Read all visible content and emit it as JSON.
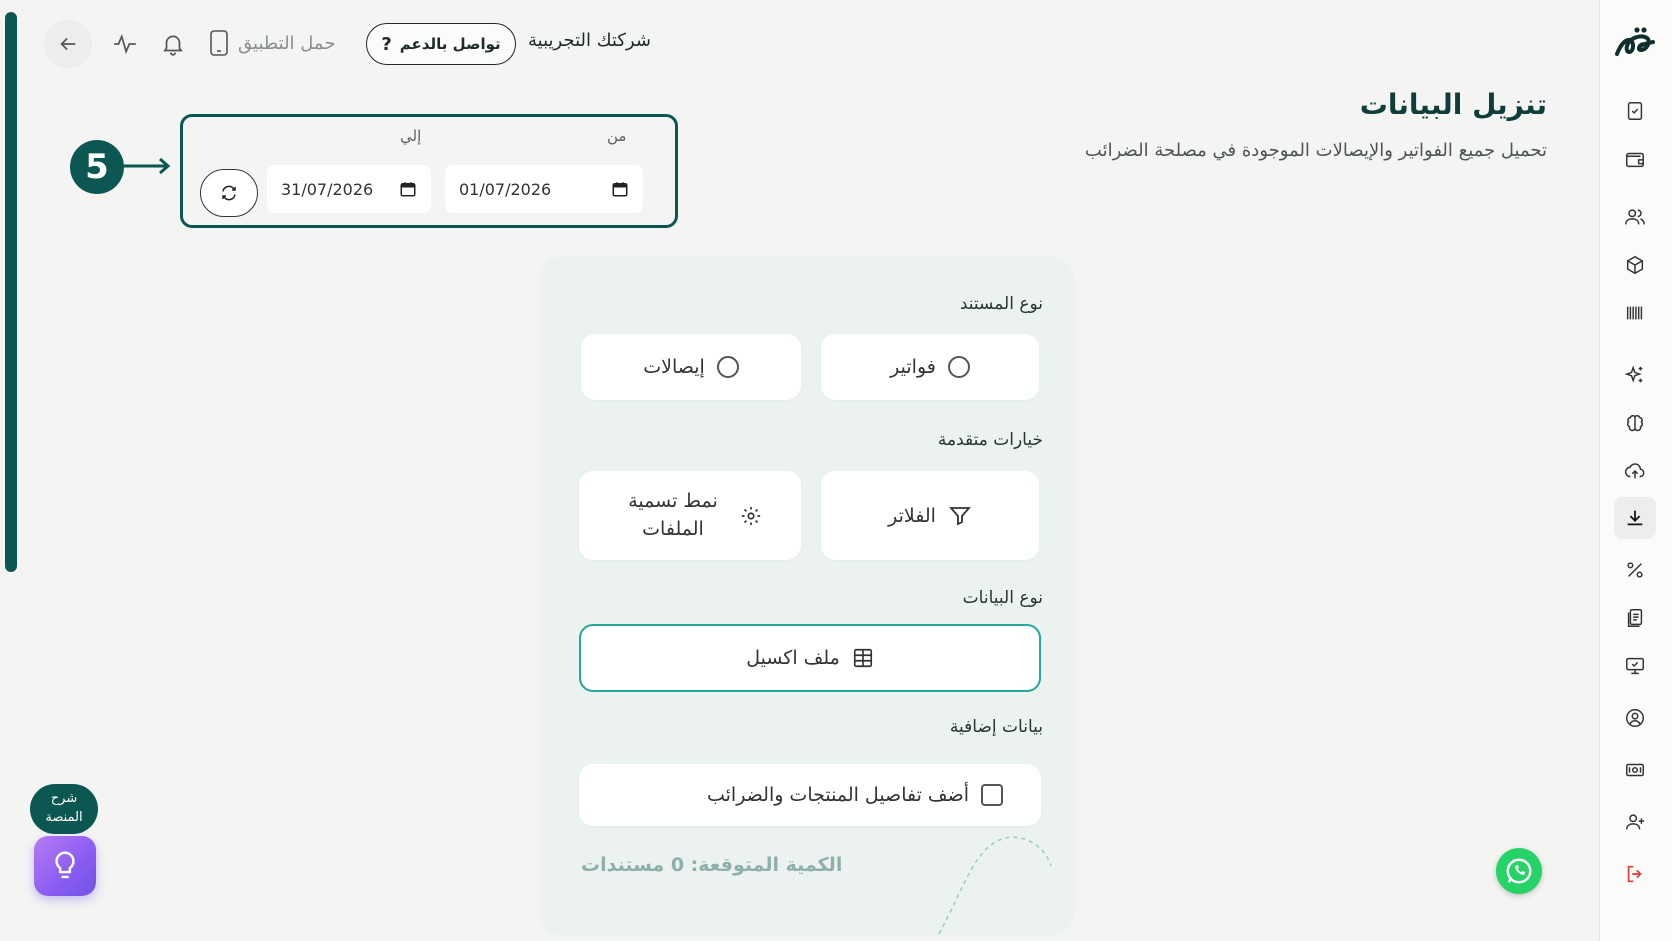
{
  "header": {
    "company_name": "شركتك التجريبية",
    "support_label": "تواصل بالدعم",
    "download_app_label": "حمل التطبيق",
    "icons": [
      "back-arrow-icon",
      "activity-icon",
      "bell-icon",
      "phone-icon",
      "question-icon"
    ]
  },
  "page": {
    "title": "تنزيل البيانات",
    "subtitle": "تحميل جميع الفواتير والإيصالات الموجودة في مصلحة الضرائب"
  },
  "date_range": {
    "from_label": "من",
    "to_label": "إلي",
    "from_value": "01/07/2026",
    "to_value": "31/07/2026"
  },
  "step_marker": {
    "number": "5"
  },
  "form": {
    "document_type_label": "نوع المستند",
    "document_types": [
      {
        "label": "فواتير",
        "selected": false
      },
      {
        "label": "إيصالات",
        "selected": false
      }
    ],
    "advanced_label": "خيارات متقدمة",
    "filters_label": "الفلاتر",
    "naming_pattern_label": "نمط تسمية الملفات",
    "data_type_label": "نوع البيانات",
    "excel_label": "ملف اكسيل",
    "extra_label": "بيانات إضافية",
    "extra_checkbox_label": "أضف تفاصيل المنتجات والضرائب",
    "extra_checked": false,
    "expected_count": "الكمية المتوقعة: 0 مستندات"
  },
  "help": {
    "bubble_text": "شرح المنصة"
  },
  "sidebar": {
    "icons": [
      "invoice-check-icon",
      "wallet-icon",
      "users-icon",
      "box-icon",
      "barcode-icon",
      "sparkles-icon",
      "brain-icon",
      "cloud-upload-icon",
      "download-icon",
      "percent-icon",
      "receipts-icon",
      "monitor-check-icon",
      "user-circle-icon",
      "cash-icon",
      "user-plus-icon",
      "logout-icon"
    ],
    "active": "download-icon"
  },
  "colors": {
    "primary": "#0d5752",
    "accent": "#22a99b",
    "logout": "#e53935"
  }
}
